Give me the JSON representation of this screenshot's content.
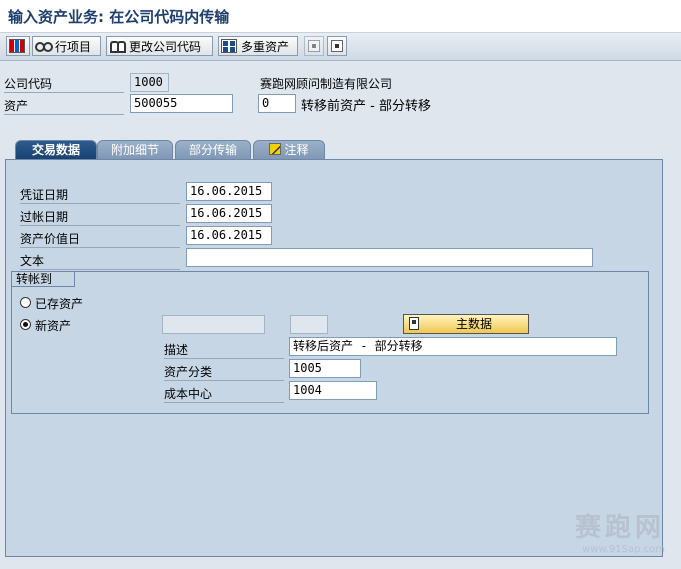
{
  "window": {
    "title": "输入资产业务: 在公司代码内传输"
  },
  "toolbar": {
    "line_items": "行项目",
    "change_company_code": "更改公司代码",
    "multiple_assets": "多重资产"
  },
  "header": {
    "company_code_label": "公司代码",
    "company_code_value": "1000",
    "company_name": "赛跑网顾问制造有限公司",
    "asset_label": "资产",
    "asset_value": "500055",
    "subnumber_value": "0",
    "asset_description": "转移前资产 - 部分转移"
  },
  "tabs": [
    {
      "label": "交易数据",
      "active": true
    },
    {
      "label": "附加细节",
      "active": false
    },
    {
      "label": "部分传输",
      "active": false
    },
    {
      "label": "注释",
      "active": false
    }
  ],
  "transaction": {
    "document_date_label": "凭证日期",
    "document_date_value": "16.06.2015",
    "posting_date_label": "过帐日期",
    "posting_date_value": "16.06.2015",
    "value_date_label": "资产价值日",
    "value_date_value": "16.06.2015",
    "text_label": "文本",
    "text_value": ""
  },
  "transfer_to": {
    "group_title": "转帐到",
    "existing_asset_label": "已存资产",
    "new_asset_label": "新资产",
    "selected": "new_asset",
    "master_data_button": "主数据",
    "description_label": "描述",
    "description_value": "转移后资产 - 部分转移",
    "asset_class_label": "资产分类",
    "asset_class_value": "1005",
    "cost_center_label": "成本中心",
    "cost_center_value": "1004"
  },
  "watermark": {
    "main": "赛跑网",
    "url": "www.91Sap.com"
  }
}
